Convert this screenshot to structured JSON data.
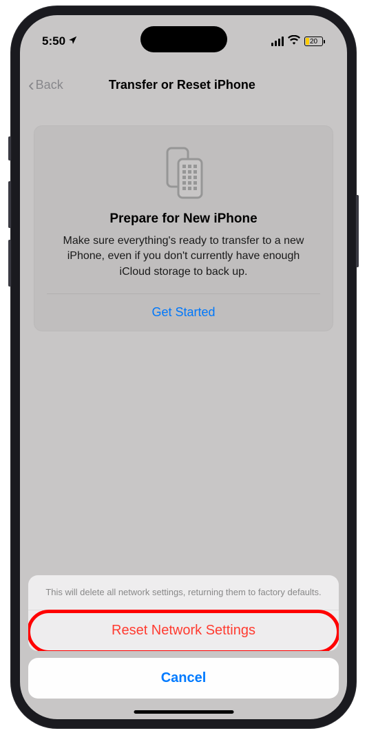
{
  "status": {
    "time": "5:50",
    "battery_pct": "20"
  },
  "nav": {
    "back_label": "Back",
    "title": "Transfer or Reset iPhone"
  },
  "card": {
    "title": "Prepare for New iPhone",
    "description": "Make sure everything's ready to transfer to a new iPhone, even if you don't currently have enough iCloud storage to back up.",
    "link": "Get Started"
  },
  "sheet": {
    "message": "This will delete all network settings, returning them to factory defaults.",
    "action": "Reset Network Settings",
    "cancel": "Cancel"
  }
}
